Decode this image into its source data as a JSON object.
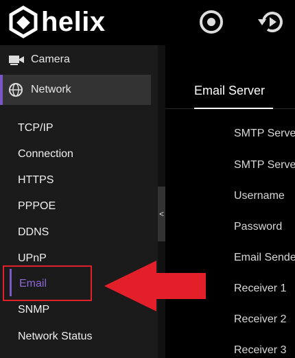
{
  "brand": {
    "name": "helix"
  },
  "header": {
    "icons": [
      "record-icon",
      "playback-icon"
    ]
  },
  "sidebar": {
    "items": [
      {
        "label": "Camera",
        "icon": "camera-icon",
        "active": false
      },
      {
        "label": "Network",
        "icon": "globe-icon",
        "active": true
      }
    ],
    "sub_items": [
      {
        "label": "TCP/IP"
      },
      {
        "label": "Connection"
      },
      {
        "label": "HTTPS"
      },
      {
        "label": "PPPOE"
      },
      {
        "label": "DDNS"
      },
      {
        "label": "UPnP"
      },
      {
        "label": "Email",
        "selected": true
      },
      {
        "label": "SNMP"
      },
      {
        "label": "Network Status"
      }
    ],
    "collapse_glyph": "<"
  },
  "main": {
    "tab": "Email Server",
    "fields": [
      "SMTP Serve",
      "SMTP Serve",
      "Username",
      "Password",
      "Email Sende",
      "Receiver 1",
      "Receiver 2",
      "Receiver 3"
    ]
  },
  "colors": {
    "accent": "#7a58c8",
    "annotation": "#e3202a",
    "sidebar_bg": "#1b1b1b"
  }
}
